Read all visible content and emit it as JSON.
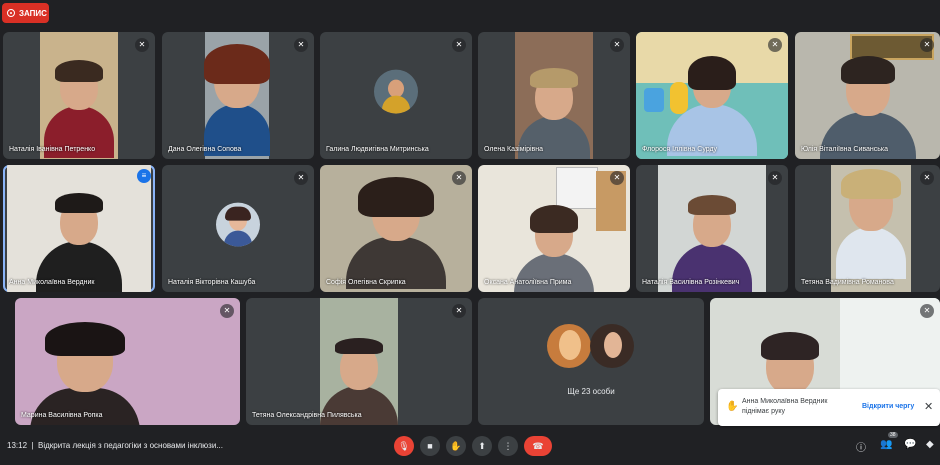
{
  "recording": {
    "label": "ЗАПИС"
  },
  "tiles": [
    {
      "name": "Наталія Іванівна Петренко"
    },
    {
      "name": "Дана Олегівна Сопова"
    },
    {
      "name": "Галина Людвигівна Митринська"
    },
    {
      "name": "Олена Казімірівна"
    },
    {
      "name": "Флорося Іллівна Сурду"
    },
    {
      "name": "Юлія Віталіївна Сиванська"
    },
    {
      "name": "Анна Миколаївна Вердник"
    },
    {
      "name": "Наталія Вікторівна Кашуба"
    },
    {
      "name": "Софія Олегівна Скрипка"
    },
    {
      "name": "Оксана Анатоліївна Прима"
    },
    {
      "name": "Наталія Василівна Розінкевич"
    },
    {
      "name": "Тетяна Вадимівна Романова"
    },
    {
      "name": "Марина Василівна Ропка"
    },
    {
      "name": "Тетяна Олександрівна Пилявська"
    },
    {
      "name": ""
    },
    {
      "name": ""
    }
  ],
  "more_people": "Ще 23 особи",
  "toast": {
    "message": "Анна Миколаївна Вердник піднімає руку",
    "link": "Відкрити чергу"
  },
  "bottom": {
    "time": "13:12",
    "separator": "|",
    "meeting_title": "Відкрита лекція з педагогіки з основами інклюзи...",
    "participants_count": "38"
  },
  "icons": {
    "mute": "mic-off-icon",
    "camera": "camera-icon",
    "raise_hand": "hand-icon",
    "present": "present-icon",
    "more": "more-icon",
    "end_call": "end-call-icon",
    "info": "info-icon",
    "people": "people-icon",
    "chat": "chat-icon",
    "activities": "activities-icon"
  },
  "colors": {
    "background": "#202124",
    "tile": "#3c4043",
    "danger": "#ea4335",
    "accent": "#1a73e8"
  }
}
